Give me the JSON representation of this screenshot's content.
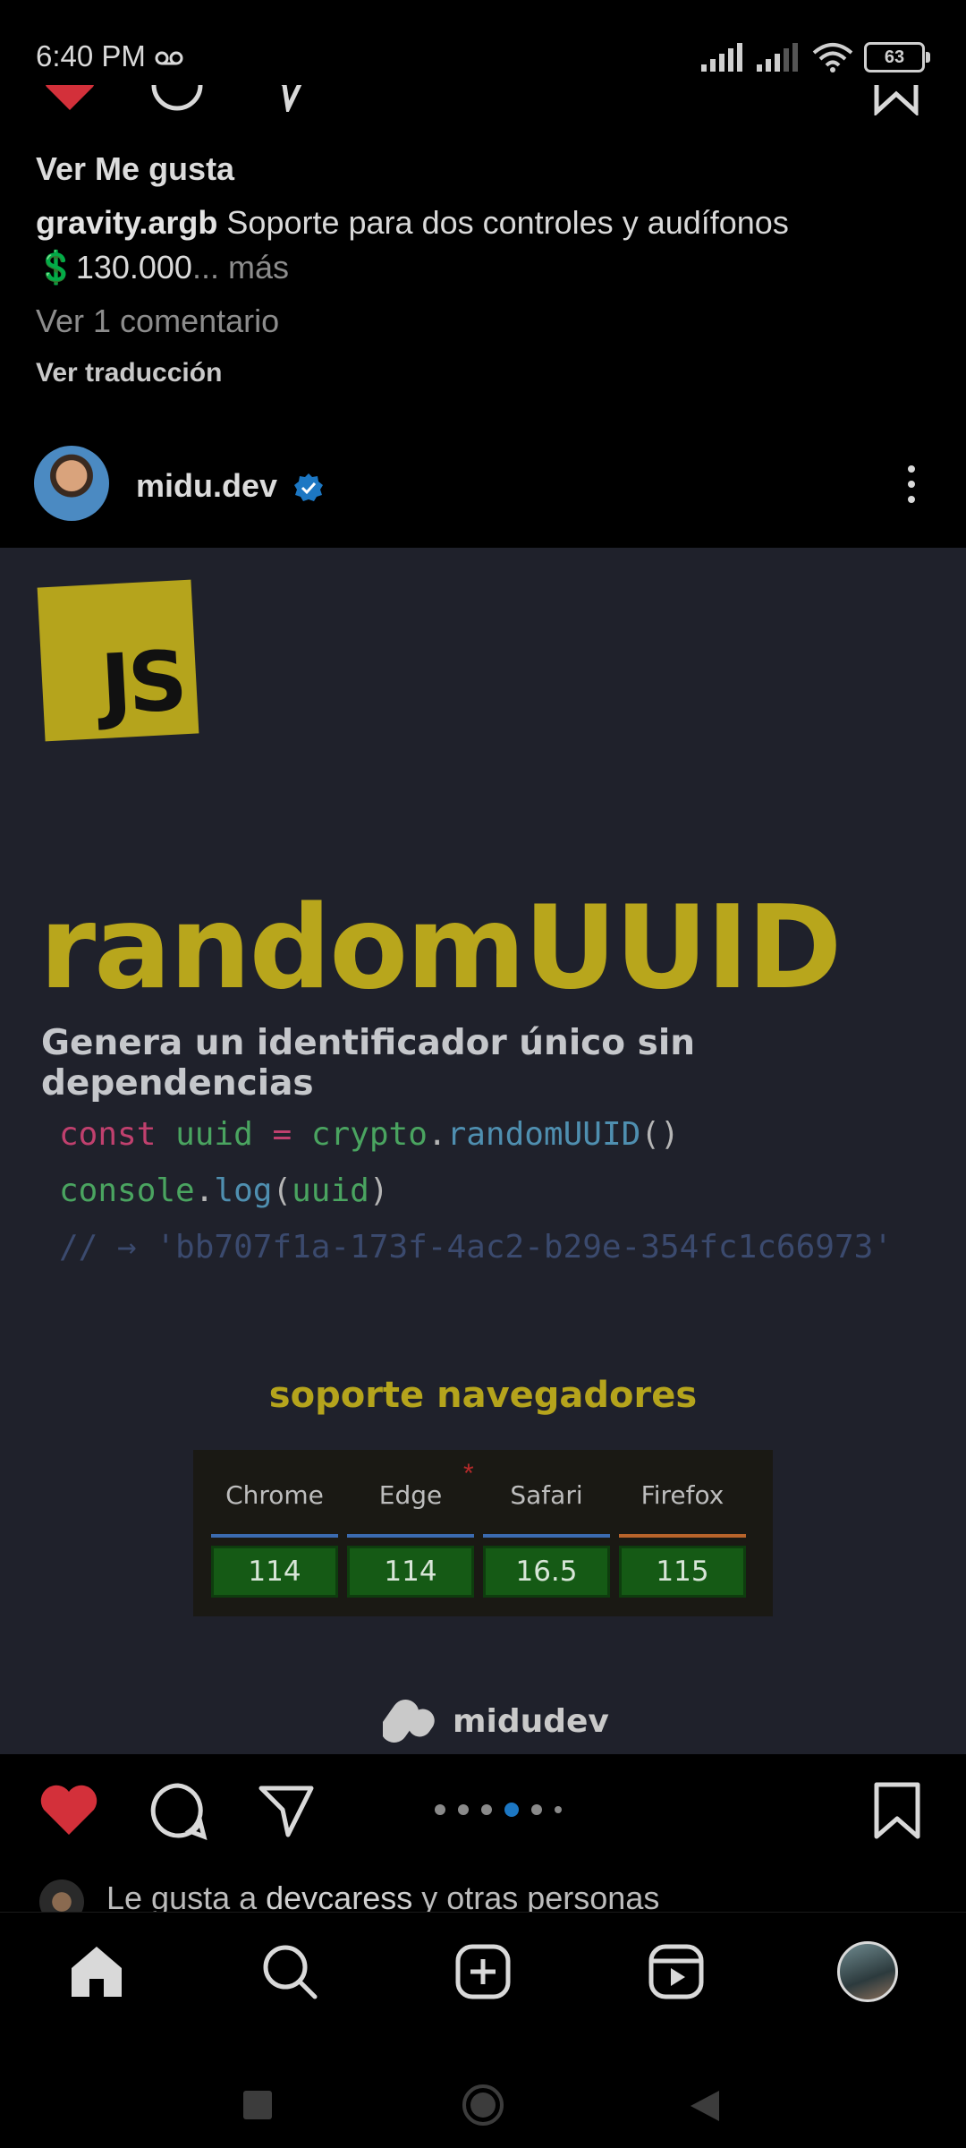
{
  "status_bar": {
    "time": "6:40 PM",
    "battery": "63"
  },
  "prev_post": {
    "likes_link": "Ver Me gusta",
    "caption_user": "gravity.argb",
    "caption_text": "Soporte para dos controles y audífonos",
    "caption_price": "💲130.000",
    "caption_more": "... más",
    "comments_link": "Ver 1 comentario",
    "translate_link": "Ver traducción"
  },
  "post": {
    "username": "midu.dev",
    "verified": true,
    "image": {
      "logo_text": "JS",
      "title": "randomUUID",
      "subtitle": "Genera un identificador único sin dependencias",
      "code": {
        "line1": {
          "kw": "const",
          "var": "uuid",
          "op": "=",
          "obj": "crypto",
          "dot": ".",
          "fn": "randomUUID",
          "paren": "()"
        },
        "line2": {
          "obj": "console",
          "dot": ".",
          "fn": "log",
          "open": "(",
          "arg": "uuid",
          "close": ")"
        },
        "line3": "// → 'bb707f1a-173f-4ac2-b29e-354fc1c66973'"
      },
      "support_title": "soporte navegadores",
      "asterisk": "*",
      "browsers": [
        {
          "name": "Chrome",
          "version": "114",
          "color": "#3b6bb0"
        },
        {
          "name": "Edge",
          "version": "114",
          "color": "#3b6bb0"
        },
        {
          "name": "Safari",
          "version": "16.5",
          "color": "#3b6bb0"
        },
        {
          "name": "Firefox",
          "version": "115",
          "color": "#b8642b"
        }
      ],
      "brand": "midudev"
    },
    "carousel": {
      "count": 6,
      "active_index": 3
    },
    "liked_by_prefix": "Le gusta a ",
    "liked_by_user": "devcaress",
    "liked_by_suffix": " y otras personas"
  },
  "colors": {
    "heart": "#d3303a",
    "accent_blue": "#1c77c3",
    "js_yellow": "#b5a41c",
    "post_bg": "#1f212b"
  },
  "nav": {
    "items": [
      "home-icon",
      "search-icon",
      "create-icon",
      "reels-icon",
      "profile-avatar"
    ]
  }
}
